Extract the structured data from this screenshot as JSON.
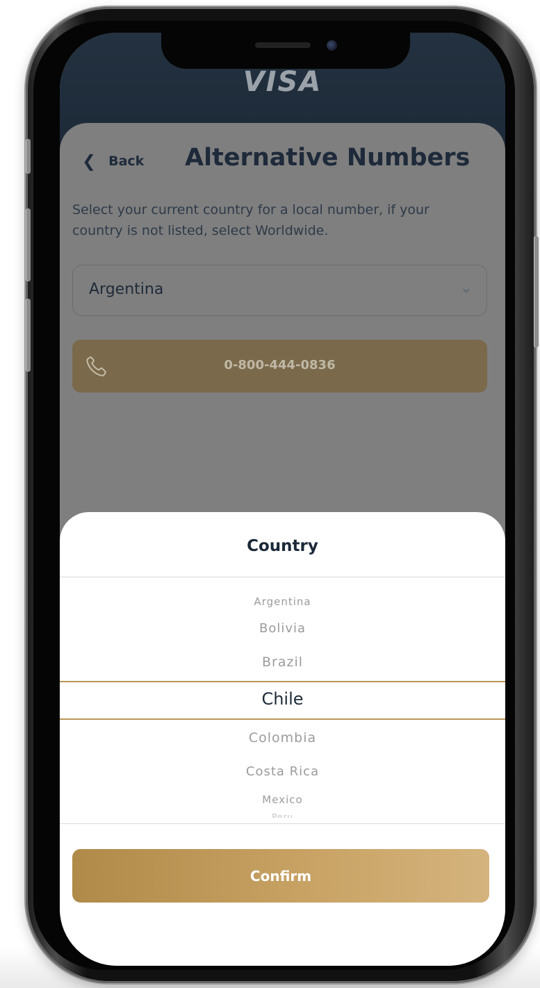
{
  "brand": {
    "logo_text": "VISA"
  },
  "header": {
    "back_label": "Back",
    "title": "Alternative Numbers"
  },
  "description": "Select your current country for a local number, if your country is not listed, select Worldwide.",
  "country_select": {
    "value": "Argentina"
  },
  "phone_number": "0-800-444-0836",
  "picker": {
    "title": "Country",
    "options": [
      "Argentina",
      "Bolivia",
      "Brazil",
      "Chile",
      "Colombia",
      "Costa Rica",
      "Mexico",
      "Peru"
    ],
    "selected": "Chile"
  },
  "confirm_label": "Confirm",
  "colors": {
    "navy": "#1e2a3a",
    "gold": "#c3a063",
    "selection_line": "#b89653"
  },
  "icons": [
    "chevron-left-icon",
    "chevron-down-icon",
    "phone-icon",
    "camera",
    "speaker"
  ]
}
